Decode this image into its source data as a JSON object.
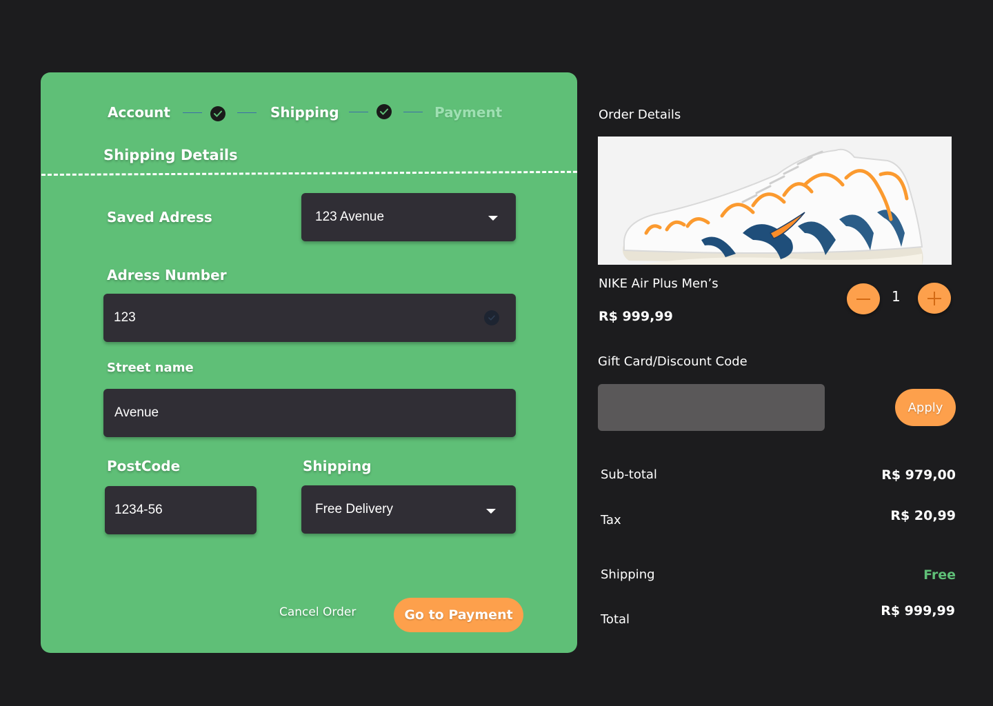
{
  "stepper": {
    "steps": [
      {
        "label": "Account",
        "state": "done"
      },
      {
        "label": "Shipping",
        "state": "done"
      },
      {
        "label": "Payment",
        "state": "inactive"
      }
    ]
  },
  "form": {
    "section_title": "Shipping Details",
    "saved_address": {
      "label": "Saved Adress",
      "value": "123 Avenue"
    },
    "address_number": {
      "label": "Adress Number",
      "value": "123"
    },
    "street_name": {
      "label": "Street name",
      "value": "Avenue"
    },
    "postcode": {
      "label": "PostCode",
      "value": "1234-56"
    },
    "shipping": {
      "label": "Shipping",
      "value": "Free Delivery"
    },
    "cancel_label": "Cancel Order",
    "submit_label": "Go to Payment"
  },
  "order": {
    "title": "Order Details",
    "product": {
      "name": "NIKE Air Plus Men’s",
      "price": "R$ 999,99",
      "quantity": "1",
      "image_icon": "sneaker-image"
    },
    "discount": {
      "label": "Gift Card/Discount Code",
      "value": "",
      "apply_label": "Apply"
    },
    "summary": {
      "subtotal_label": "Sub-total",
      "subtotal_value": "R$ 979,00",
      "tax_label": "Tax",
      "tax_value": "R$ 20,99",
      "shipping_label": "Shipping",
      "shipping_value": "Free",
      "total_label": "Total",
      "total_value": "R$ 999,99"
    }
  },
  "colors": {
    "background": "#1c1c1e",
    "card": "#5fbf77",
    "field": "#302e35",
    "accent": "#fda04c",
    "free": "#5fbf77"
  }
}
